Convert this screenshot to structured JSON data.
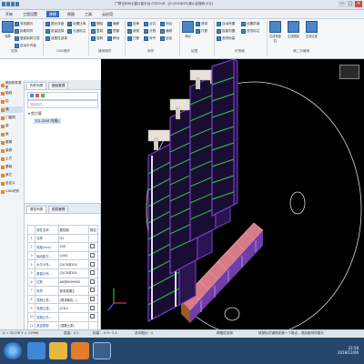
{
  "app": {
    "title": "广联达BIM土建计量平台 GTJ2018 - [E:\\2018GTJ\\某小区楼栋.GTJ]",
    "window_buttons": [
      "—",
      "□",
      "×"
    ]
  },
  "menu": {
    "tabs": [
      "开始",
      "工程设置",
      "建模",
      "视图",
      "工具",
      "云应用"
    ],
    "active_index": 2
  },
  "ribbon": {
    "buttons": [
      "选择",
      "查找图元",
      "拾取构件",
      "复制到其它层",
      "自动平齐板",
      "图元存盘",
      "批量选择",
      "按属性选择",
      "设置比例",
      "长度标注",
      "删除",
      "复制",
      "旋转",
      "偏移",
      "镜像",
      "移动",
      "延伸",
      "修剪",
      "打断",
      "合并",
      "分割",
      "对齐",
      "闭合",
      "偏移",
      "锁定",
      "两点",
      "修改",
      "打断",
      "自动布置",
      "智能布置",
      "查改标高",
      "设置拱墙",
      "查改标注",
      "生成构造柱",
      "生成圈梁",
      "生成过梁"
    ],
    "groups": [
      "选择",
      "CAD操作",
      "通用操作",
      "修改",
      "绘图",
      "识别墙",
      "墙二次编辑"
    ]
  },
  "left_nav": {
    "items": [
      "常用构件类型",
      "轴线",
      "柱",
      "墙",
      "门窗洞",
      "梁",
      "板",
      "楼梯",
      "装修",
      "土方",
      "基础",
      "其它",
      "自定义",
      "CAD识别"
    ],
    "selected_index": 3
  },
  "component_list": {
    "tabs": [
      "构件列表",
      "图纸管理"
    ],
    "search_placeholder": "搜索构件...",
    "tree_root": "剪力墙",
    "tree_item": "Q1 [200 内墙]"
  },
  "property_panel": {
    "tabs": [
      "属性列表",
      "图层管理"
    ],
    "headers": [
      "属性名称",
      "属性值",
      "附加"
    ],
    "rows": [
      {
        "num": "1",
        "name": "名称",
        "value": "Q1"
      },
      {
        "num": "2",
        "name": "厚度(mm)",
        "value": "200"
      },
      {
        "num": "3",
        "name": "轴线距左...",
        "value": "(100)"
      },
      {
        "num": "4",
        "name": "水平分布...",
        "value": "(2)C8@200"
      },
      {
        "num": "5",
        "name": "垂直分布...",
        "value": "(2)C8@200"
      },
      {
        "num": "6",
        "name": "拉筋",
        "value": "A6@600*600"
      },
      {
        "num": "7",
        "name": "材质",
        "value": "现浇混凝土"
      },
      {
        "num": "8",
        "name": "混凝土类...",
        "value": "(现浇砾石...)"
      },
      {
        "num": "9",
        "name": "混凝土强...",
        "value": "(C30)"
      },
      {
        "num": "10",
        "name": "混凝土外...",
        "value": ""
      },
      {
        "num": "11",
        "name": "泵送类型",
        "value": "(混凝土泵)"
      }
    ]
  },
  "status_bar": {
    "coords": "X = 32108  Y = 11966",
    "floor_height": "层高：4.2",
    "elevation": "标高：-0.9~3.3",
    "selection": "选中图元：0",
    "snap": "跨图层选择",
    "hint": "按鼠标左键指定第一个角点，或拾取构件图元"
  },
  "taskbar": {
    "time": "23:58",
    "date": "2018/12/06"
  },
  "colors": {
    "accent": "#2e6fbe",
    "viewport_bg": "#000000",
    "taskbar_bg": "#26476b",
    "wall_purple": "#7b3fd0",
    "beam_green": "#2fb24a",
    "slab_pink": "#e79aa6"
  },
  "icons": [
    "start-orb-icon",
    "ie-browser-icon",
    "explorer-folder-icon",
    "media-player-icon",
    "glodon-app-icon",
    "viewcube-icon"
  ]
}
